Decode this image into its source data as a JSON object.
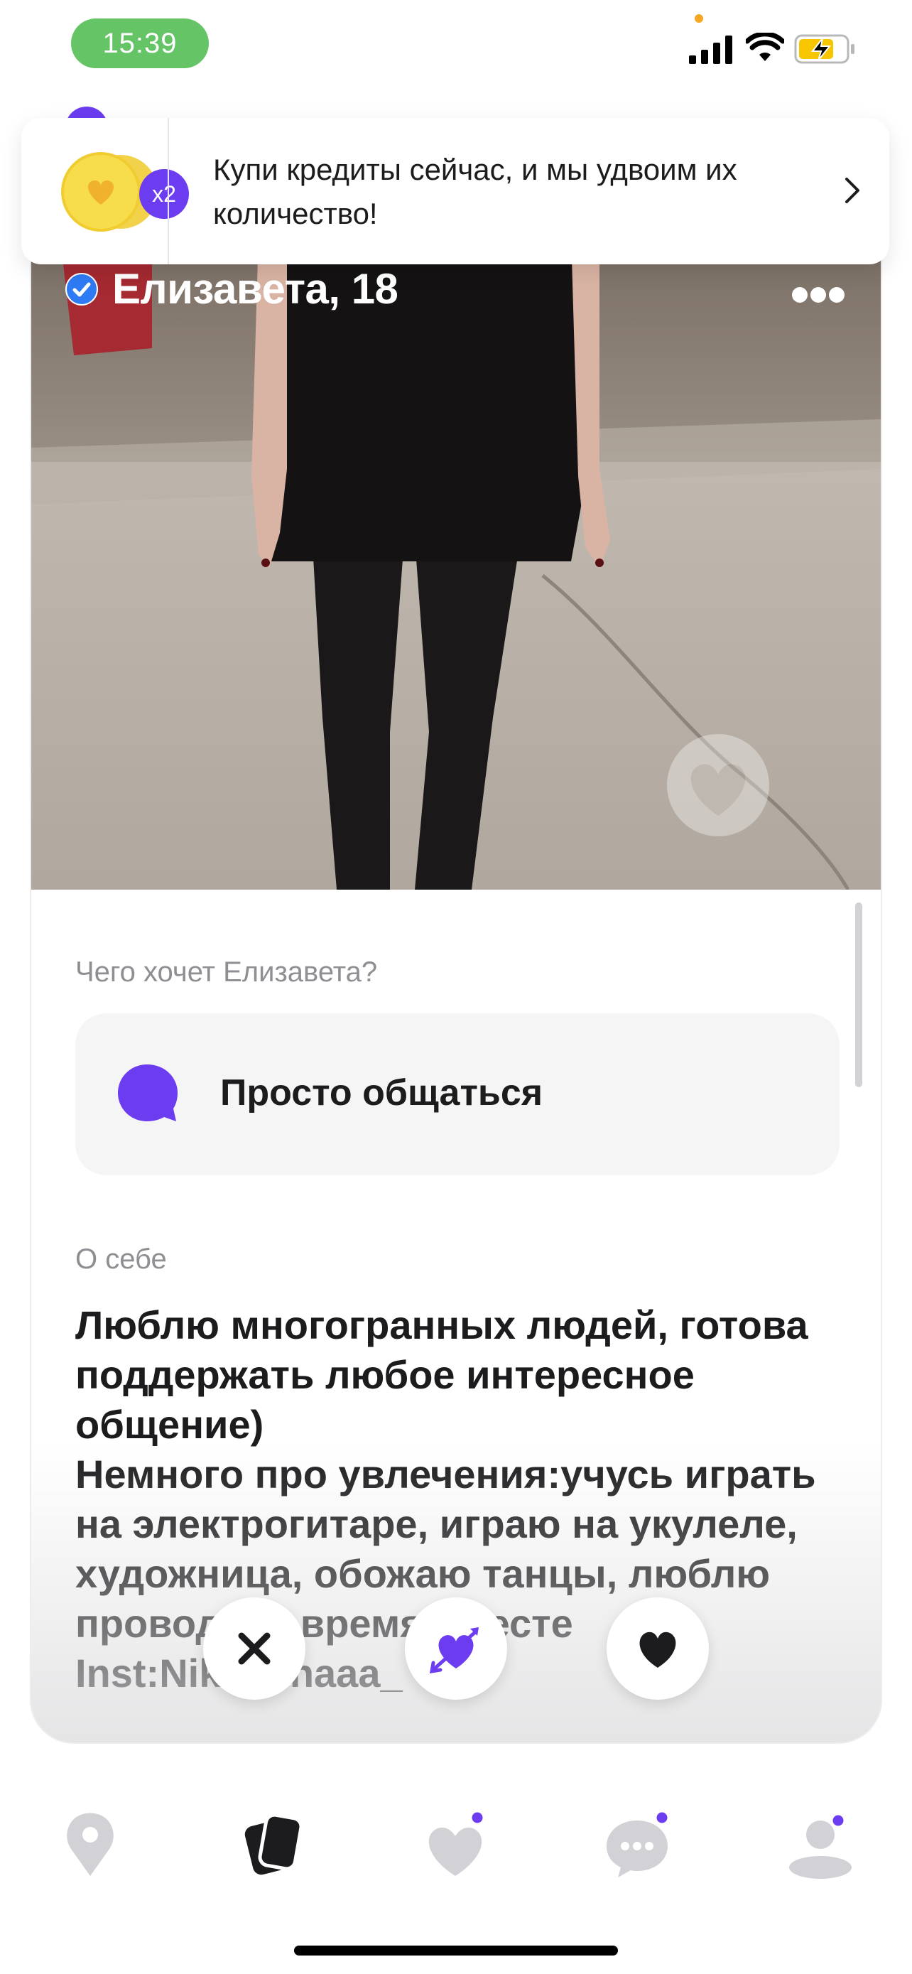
{
  "status": {
    "time": "15:39"
  },
  "promo": {
    "multiplier": "x2",
    "text": "Купи кредиты сейчас, и мы удвоим их количество!"
  },
  "profile": {
    "name": "Елизавета, 18",
    "verified": true,
    "want_label": "Чего хочет Елизавета?",
    "want_value": "Просто общаться",
    "about_label": "О себе",
    "about_text": "Люблю многогранных людей, готова поддержать любое интересное общение)\nНемного про увлечения:учусь играть на электрогитаре, играю на укулеле, художница, обожаю танцы, люблю проводить время вместе\nInst:Nikishinaaa_"
  },
  "actions": [
    "close-icon",
    "cupid-heart-icon",
    "heart-icon"
  ],
  "tabs": [
    "map-pin-icon",
    "cards-icon",
    "likes-icon",
    "chats-icon",
    "profile-icon"
  ],
  "colors": {
    "accent": "#6c3cf0",
    "time_pill": "#65c466",
    "verified": "#2f7bf5"
  }
}
